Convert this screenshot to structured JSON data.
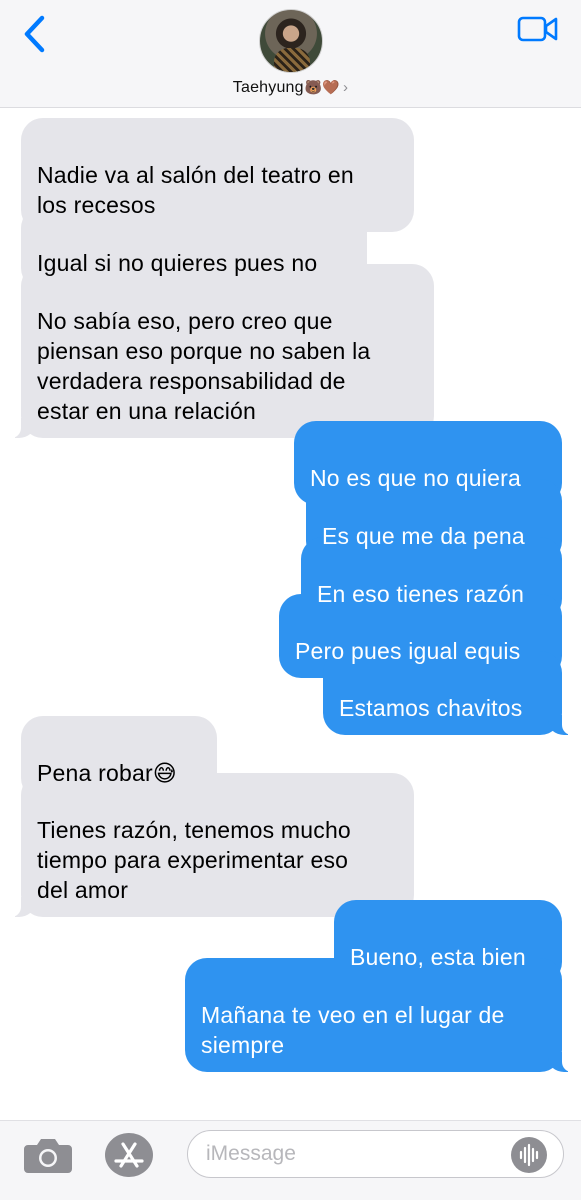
{
  "header": {
    "contact_name": "Taehyung",
    "contact_emoji": "🐻🤎",
    "chevron": "›"
  },
  "messages": [
    {
      "direction": "incoming",
      "text": "Nadie va al salón del teatro en\nlos recesos"
    },
    {
      "direction": "incoming",
      "text": "Igual si no quieres pues no"
    },
    {
      "direction": "incoming",
      "text": "No sabía eso, pero creo que\npiensan eso porque no saben la\nverdadera responsabilidad de\nestar en una relación"
    },
    {
      "direction": "outgoing",
      "text": "No es que no quiera"
    },
    {
      "direction": "outgoing",
      "text": "Es que me da pena"
    },
    {
      "direction": "outgoing",
      "text": "En eso tienes razón"
    },
    {
      "direction": "outgoing",
      "text": "Pero pues igual equis"
    },
    {
      "direction": "outgoing",
      "text": "Estamos chavitos"
    },
    {
      "direction": "incoming",
      "text": "Pena robar😅"
    },
    {
      "direction": "incoming",
      "text": "Tienes razón, tenemos mucho\ntiempo para experimentar eso\ndel amor"
    },
    {
      "direction": "outgoing",
      "text": "Bueno, esta bien"
    },
    {
      "direction": "outgoing",
      "text": "Mañana te veo en el lugar de\nsiempre"
    }
  ],
  "composer": {
    "placeholder": "iMessage",
    "value": ""
  },
  "icons": {
    "back": "chevron-left-icon",
    "video": "video-camera-icon",
    "camera": "camera-icon",
    "appstore": "app-store-icon",
    "audio": "audio-waveform-icon"
  },
  "colors": {
    "accent": "#007aff",
    "outgoing_bubble": "#2f93f0",
    "incoming_bubble": "#e5e5ea"
  }
}
